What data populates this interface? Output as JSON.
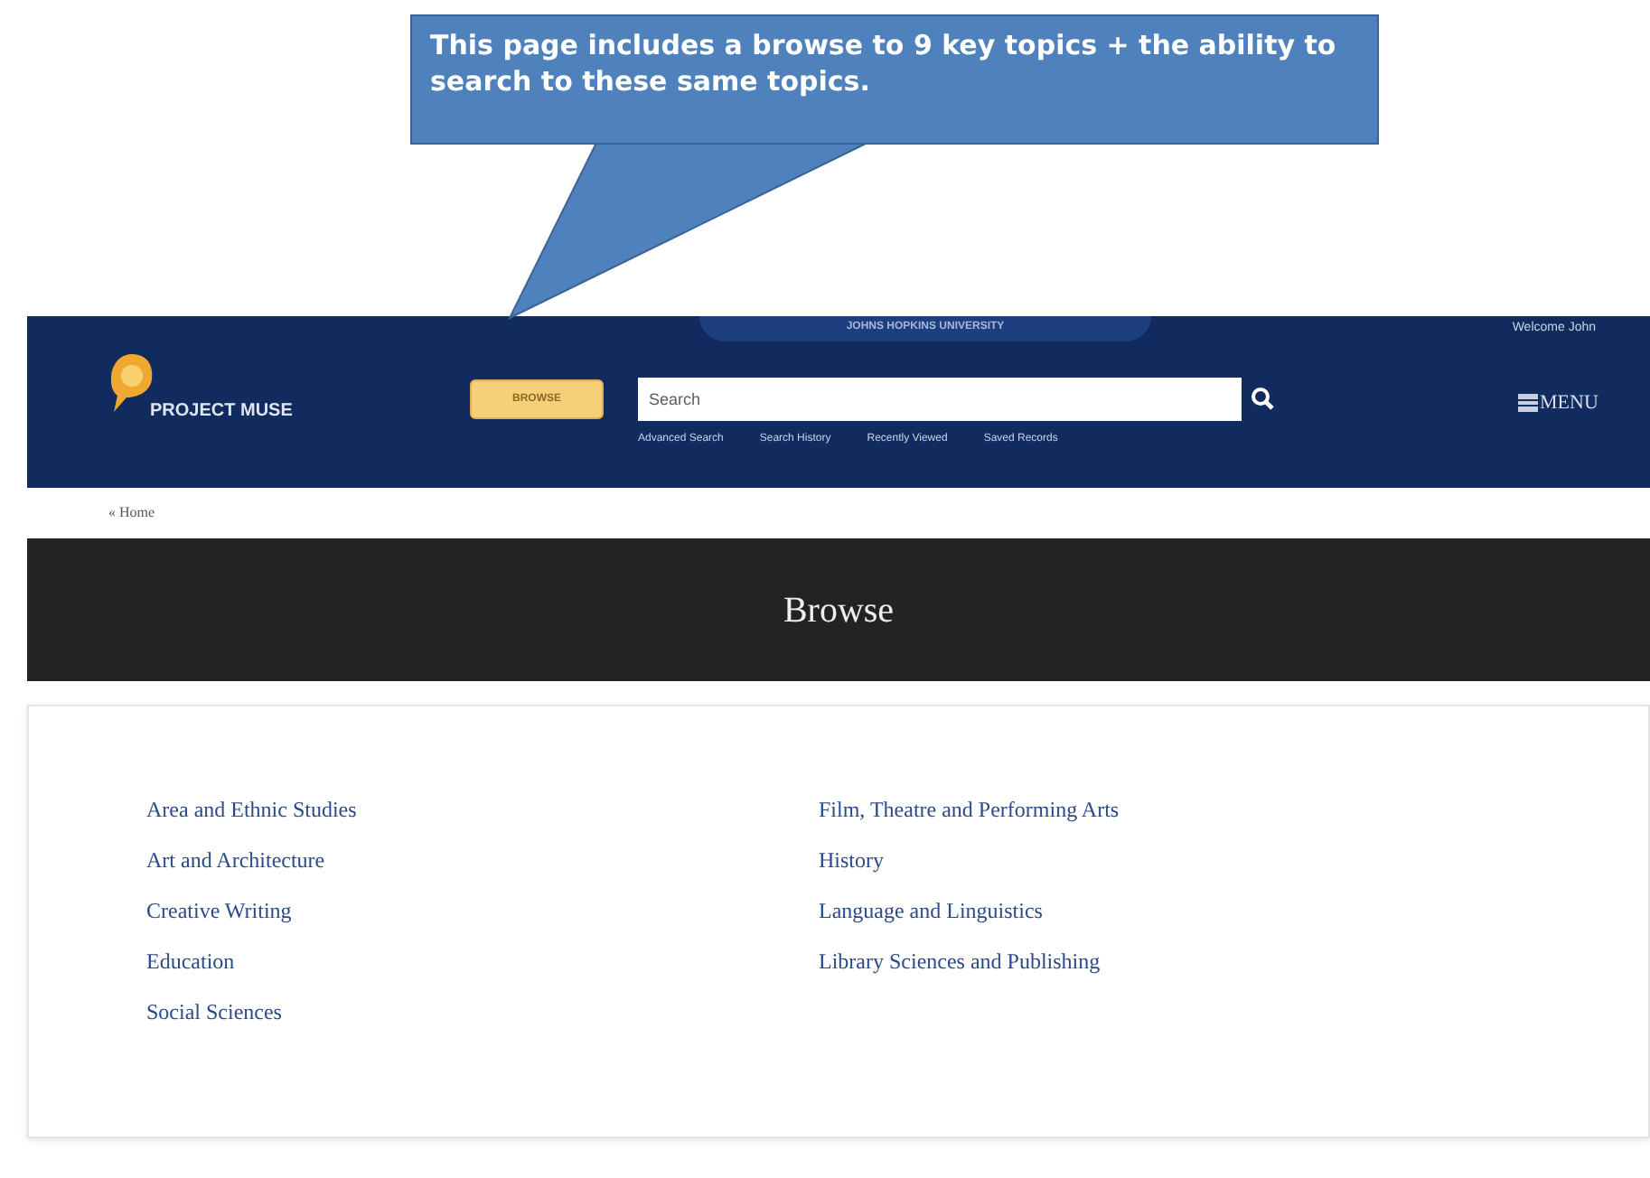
{
  "callout": {
    "text": "This page includes a browse to 9 key topics + the ability to search to these same topics."
  },
  "header": {
    "logo": "PROJECT MUSE",
    "institution": "JOHNS HOPKINS UNIVERSITY",
    "welcome": "Welcome John",
    "browse_button": "BROWSE",
    "search": {
      "placeholder": "Search"
    },
    "links": [
      "Advanced Search",
      "Search History",
      "Recently Viewed",
      "Saved Records"
    ],
    "menu": "MENU"
  },
  "breadcrumb": "« Home",
  "banner": {
    "title": "Browse"
  },
  "topics": [
    [
      "Area and Ethnic Studies",
      "Art and Architecture",
      "Creative Writing",
      "Education",
      "Social Sciences"
    ],
    [
      "Film, Theatre and Performing Arts",
      "History",
      "Language and Linguistics",
      "Library Sciences and Publishing"
    ]
  ]
}
